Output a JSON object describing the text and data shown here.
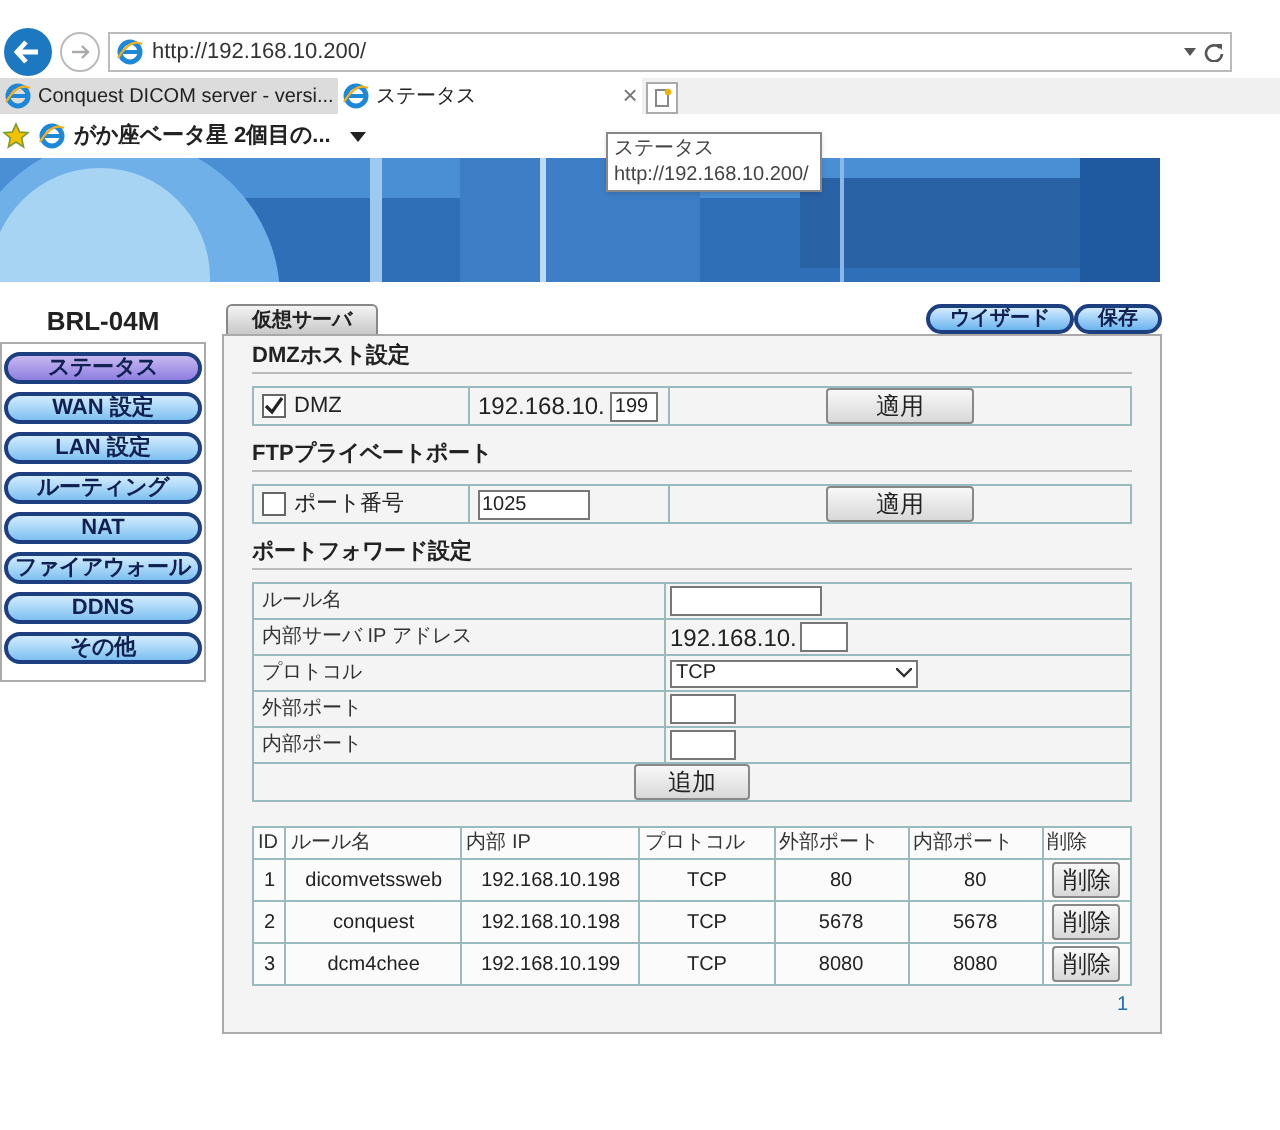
{
  "browser": {
    "address": "http://192.168.10.200/",
    "tabs": [
      {
        "label": "Conquest DICOM server - versi...",
        "selected": false
      },
      {
        "label": "ステータス",
        "selected": true,
        "close": "×"
      }
    ],
    "favorite": "がか座ベータ星 2個目の...",
    "tooltip": {
      "title": "ステータス",
      "url": "http://192.168.10.200/"
    }
  },
  "banner": {
    "kind": "picture"
  },
  "sidebar": {
    "device": "BRL-04M",
    "items": [
      {
        "label": "ステータス",
        "selected": true
      },
      {
        "label": "WAN 設定",
        "selected": false
      },
      {
        "label": "LAN 設定",
        "selected": false
      },
      {
        "label": "ルーティング",
        "selected": false
      },
      {
        "label": "NAT",
        "selected": false
      },
      {
        "label": "ファイアウォール",
        "selected": false
      },
      {
        "label": "DDNS",
        "selected": false
      },
      {
        "label": "その他",
        "selected": false
      }
    ]
  },
  "page_tab": "仮想サーバ",
  "top_buttons": [
    "ウイザード",
    "保存"
  ],
  "dmz": {
    "heading": "DMZホスト設定",
    "label": "DMZ",
    "checked": true,
    "prefix": "192.168.10.",
    "value": "199",
    "button": "適用"
  },
  "ftp": {
    "heading": "FTPプライベートポート",
    "label": "ポート番号",
    "checked": false,
    "value": "1025",
    "button": "適用"
  },
  "forward": {
    "heading": "ポートフォワード設定",
    "fields": [
      {
        "label": "ルール名",
        "kind": "text"
      },
      {
        "label": "内部サーバ IP アドレス",
        "kind": "ip",
        "prefix": "192.168.10."
      },
      {
        "label": "プロトコル",
        "kind": "select",
        "value": "TCP"
      },
      {
        "label": "外部ポート",
        "kind": "port"
      },
      {
        "label": "内部ポート",
        "kind": "port"
      }
    ],
    "button": "追加"
  },
  "rules": {
    "columns": [
      "ID",
      "ルール名",
      "内部 IP",
      "プロトコル",
      "外部ポート",
      "内部ポート",
      "削除"
    ],
    "rows": [
      [
        "1",
        "dicomvetssweb",
        "192.168.10.198",
        "TCP",
        "80",
        "80",
        "削除"
      ],
      [
        "2",
        "conquest",
        "192.168.10.198",
        "TCP",
        "5678",
        "5678",
        "削除"
      ],
      [
        "3",
        "dcm4chee",
        "192.168.10.199",
        "TCP",
        "8080",
        "8080",
        "削除"
      ]
    ],
    "page": "1"
  }
}
